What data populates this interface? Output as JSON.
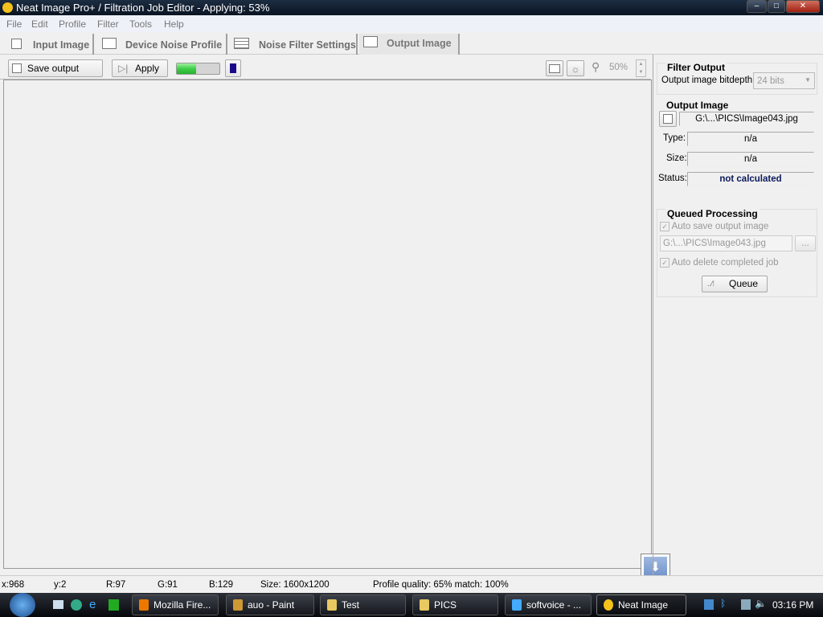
{
  "window": {
    "title": "Neat Image Pro+ / Filtration Job Editor - Applying: 53%",
    "minimize": "–",
    "maximize": "□",
    "close": "✕"
  },
  "menu": [
    "File",
    "Edit",
    "Profile",
    "Filter",
    "Tools",
    "Help"
  ],
  "tabs": [
    {
      "label": "Input Image",
      "icon": "input-image-icon"
    },
    {
      "label": "Device Noise Profile",
      "icon": "camera-icon"
    },
    {
      "label": "Noise Filter Settings",
      "icon": "filter-settings-icon"
    },
    {
      "label": "Output Image",
      "icon": "output-image-icon",
      "active": true
    }
  ],
  "toolbar": {
    "save_label": "Save output image",
    "apply_label": "Apply",
    "progress_percent": 53,
    "zoom": "50%"
  },
  "filter_output": {
    "title": "Filter Output",
    "bitdepth_label": "Output image bitdepth:",
    "bitdepth_value": "24 bits"
  },
  "output_image": {
    "title": "Output Image",
    "path": "G:\\...\\PICS\\Image043.jpg",
    "type_label": "Type:",
    "type_value": "n/a",
    "size_label": "Size:",
    "size_value": "n/a",
    "status_label": "Status:",
    "status_value": "not calculated"
  },
  "queued": {
    "title": "Queued Processing",
    "auto_save_label": "Auto save output image",
    "path": "G:\\...\\PICS\\Image043.jpg",
    "browse": "...",
    "auto_delete_label": "Auto delete completed job",
    "queue_label": "Queue"
  },
  "statusbar": {
    "x": "x:968",
    "y": "y:2",
    "r": "R:97",
    "g": "G:91",
    "b": "B:129",
    "size": "Size: 1600x1200",
    "profile": "Profile quality: 65%  match: 100%"
  },
  "taskbar": {
    "items": [
      "Mozilla Fire...",
      "auo - Paint",
      "Test",
      "PICS",
      "softvoice - ...",
      "Neat Image"
    ],
    "clock": "03:16 PM"
  },
  "colors": {
    "progress": "#3ecf4a",
    "status_value": "#0a1a5a",
    "stop": "#1a0a8a"
  }
}
